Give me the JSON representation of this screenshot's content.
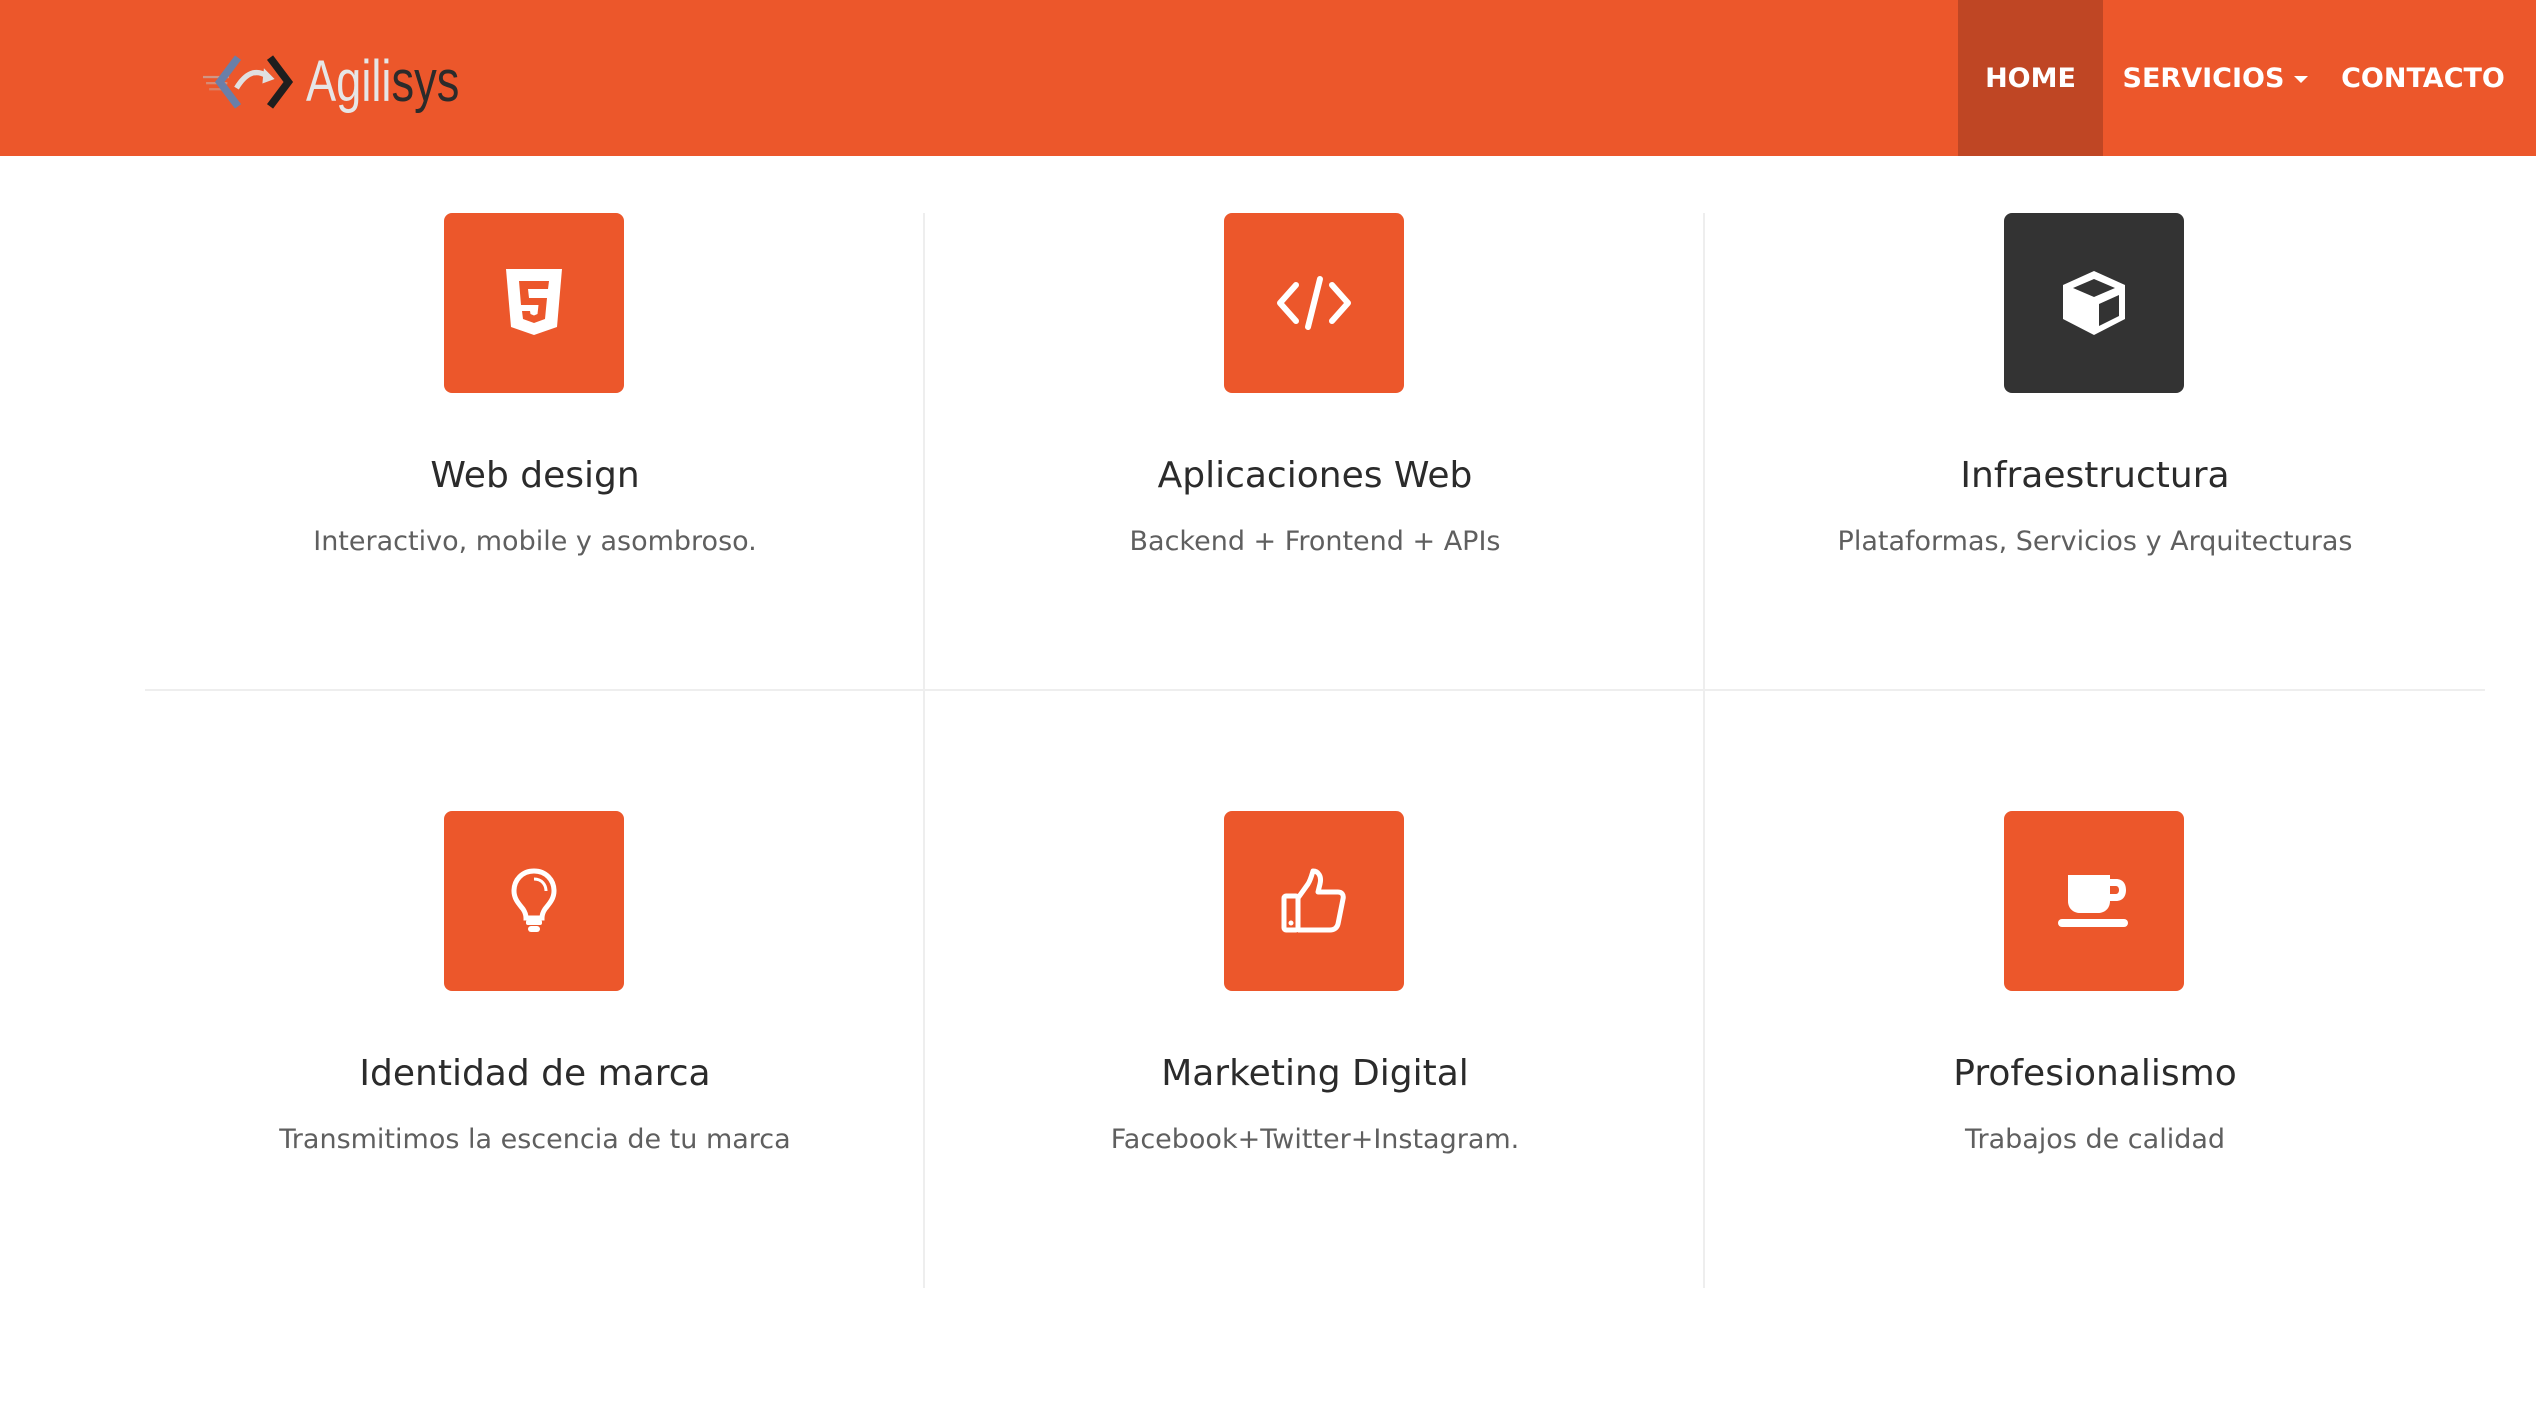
{
  "brand": {
    "name_part1": "Agili",
    "name_part2": "sys",
    "accent_color": "#ec572b",
    "active_nav_color": "#bf4624",
    "dark_icon_color": "#333333"
  },
  "nav": {
    "items": [
      {
        "label": "HOME",
        "active": true
      },
      {
        "label": "SERVICIOS",
        "dropdown": true
      },
      {
        "label": "CONTACTO"
      }
    ]
  },
  "services": [
    {
      "icon": "html5-icon",
      "title": "Web design",
      "description": "Interactivo, mobile y asombroso."
    },
    {
      "icon": "code-icon",
      "title": "Aplicaciones Web",
      "description": "Backend + Frontend + APIs"
    },
    {
      "icon": "cube-icon",
      "title": "Infraestructura",
      "description": "Plataformas, Servicios y Arquitecturas"
    },
    {
      "icon": "lightbulb-icon",
      "title": "Identidad de marca",
      "description": "Transmitimos la escencia de tu marca"
    },
    {
      "icon": "thumbs-up-icon",
      "title": "Marketing Digital",
      "description": "Facebook+Twitter+Instagram."
    },
    {
      "icon": "coffee-icon",
      "title": "Profesionalismo",
      "description": "Trabajos de calidad"
    }
  ]
}
